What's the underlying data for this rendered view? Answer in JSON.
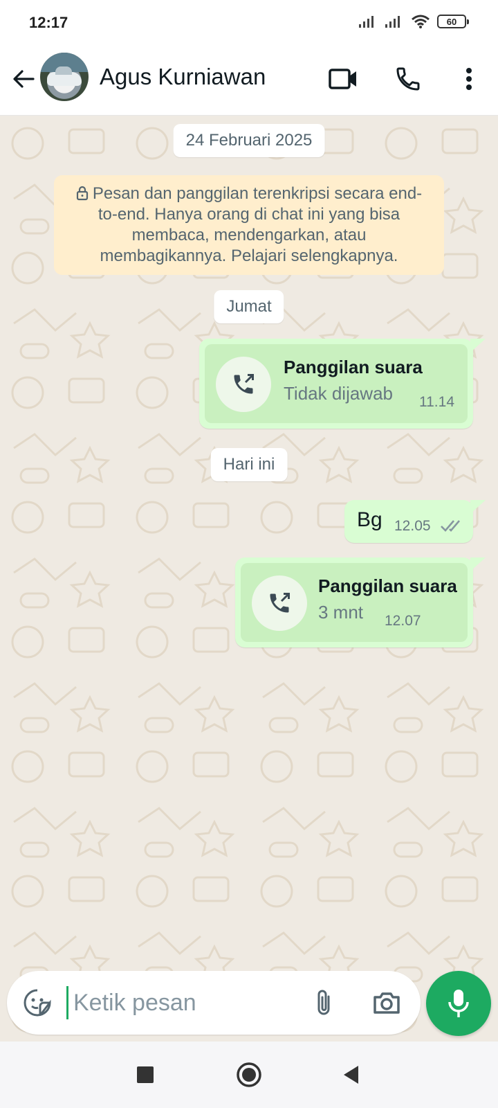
{
  "status": {
    "time": "12:17",
    "battery": "60"
  },
  "header": {
    "contact_name": "Agus Kurniawan"
  },
  "chat": {
    "date_first": "24 Februari 2025",
    "encryption_notice": "Pesan dan panggilan terenkripsi secara end-to-end. Hanya orang di chat ini yang bisa membaca, mendengarkan, atau membagikannya. Pelajari selengkapnya.",
    "date_second": "Jumat",
    "call1": {
      "title": "Panggilan suara",
      "subtitle": "Tidak dijawab",
      "time": "11.14"
    },
    "date_third": "Hari ini",
    "text_message": {
      "text": "Bg",
      "time": "12.05",
      "status": "read"
    },
    "call2": {
      "title": "Panggilan suara",
      "subtitle": "3 mnt",
      "time": "12.07"
    }
  },
  "composer": {
    "placeholder": "Ketik pesan"
  },
  "colors": {
    "accent": "#1daa61",
    "outgoing_bubble": "#d9fdd3",
    "chat_bg": "#efeae2",
    "encryption_bg": "#ffeecd"
  }
}
